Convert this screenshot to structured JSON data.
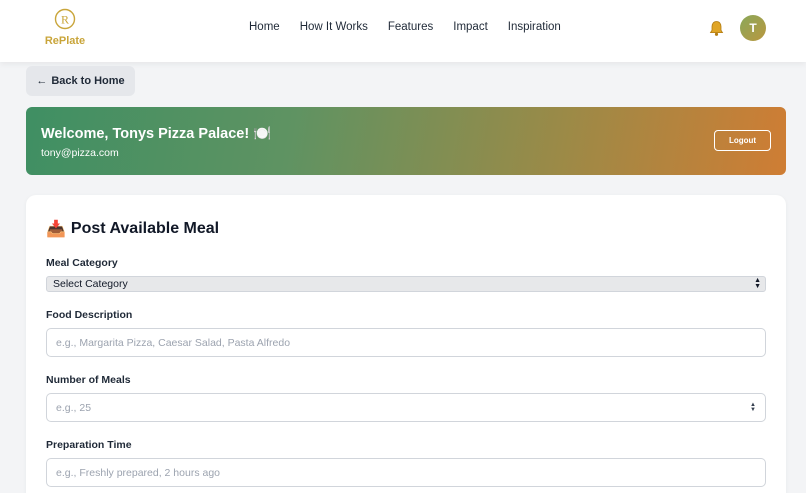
{
  "header": {
    "brand_name": "RePlate",
    "logo_letter": "R",
    "nav": [
      "Home",
      "How It Works",
      "Features",
      "Impact",
      "Inspiration"
    ],
    "avatar_initial": "T",
    "icons": {
      "notification": "bell-icon"
    },
    "colors": {
      "brand": "#c9a53a",
      "avatar": "#8aa85a"
    }
  },
  "back_button": {
    "arrow": "←",
    "label": "Back to Home"
  },
  "banner": {
    "title": "Welcome, Tonys Pizza Palace!",
    "emoji": "🍽️",
    "email": "tony@pizza.com",
    "logout_label": "Logout",
    "gradient_start": "#3f8f63",
    "gradient_end": "#cf7d34"
  },
  "form": {
    "title_icon": "📥",
    "title": "Post Available Meal",
    "meal_category": {
      "label": "Meal Category",
      "value": "Select Category"
    },
    "food_description": {
      "label": "Food Description",
      "placeholder": "e.g., Margarita Pizza, Caesar Salad, Pasta Alfredo"
    },
    "number_of_meals": {
      "label": "Number of Meals",
      "placeholder": "e.g., 25"
    },
    "preparation_time": {
      "label": "Preparation Time",
      "placeholder": "e.g., Freshly prepared, 2 hours ago"
    }
  }
}
